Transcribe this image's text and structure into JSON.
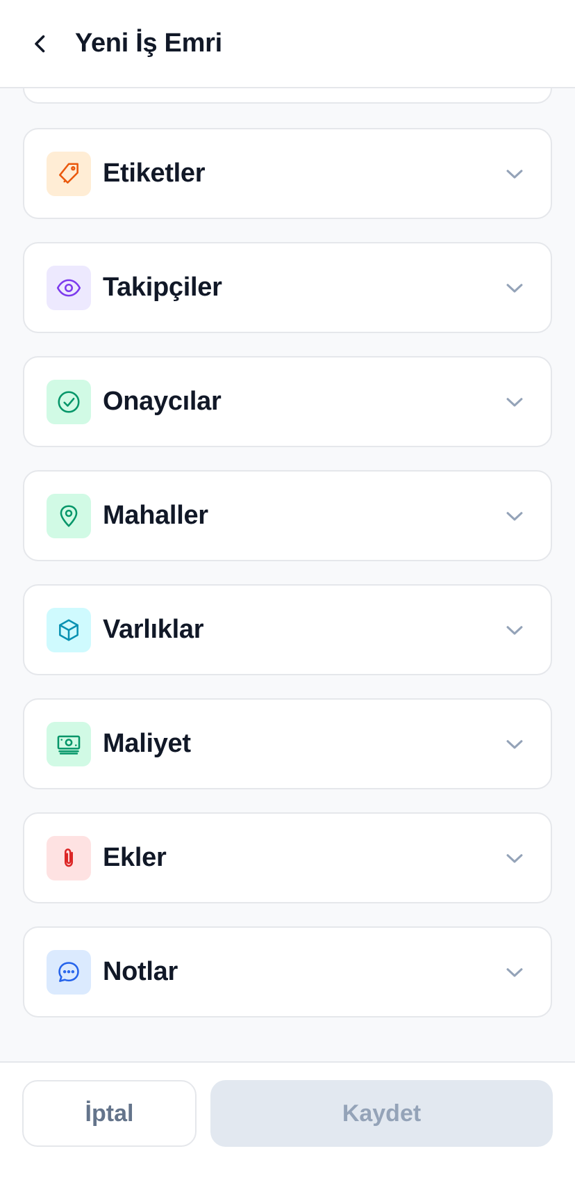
{
  "header": {
    "title": "Yeni İş Emri",
    "back_icon": "chevron-left-icon"
  },
  "sections": [
    {
      "key": "tags",
      "label": "Etiketler",
      "icon": "tag-icon",
      "icon_bg": "#ffedd5",
      "icon_color": "#ea580c"
    },
    {
      "key": "followers",
      "label": "Takipçiler",
      "icon": "eye-icon",
      "icon_bg": "#ede9fe",
      "icon_color": "#7c3aed"
    },
    {
      "key": "approvers",
      "label": "Onaycılar",
      "icon": "check-circle-icon",
      "icon_bg": "#d1fae5",
      "icon_color": "#059669"
    },
    {
      "key": "locations",
      "label": "Mahaller",
      "icon": "map-pin-icon",
      "icon_bg": "#d1fae5",
      "icon_color": "#059669"
    },
    {
      "key": "assets",
      "label": "Varlıklar",
      "icon": "cube-icon",
      "icon_bg": "#cffafe",
      "icon_color": "#0891b2"
    },
    {
      "key": "cost",
      "label": "Maliyet",
      "icon": "banknotes-icon",
      "icon_bg": "#d1fae5",
      "icon_color": "#059669"
    },
    {
      "key": "attachments",
      "label": "Ekler",
      "icon": "paperclip-icon",
      "icon_bg": "#fee2e2",
      "icon_color": "#dc2626"
    },
    {
      "key": "notes",
      "label": "Notlar",
      "icon": "chat-bubble-icon",
      "icon_bg": "#dbeafe",
      "icon_color": "#2563eb"
    }
  ],
  "footer": {
    "cancel_label": "İptal",
    "save_label": "Kaydet"
  },
  "colors": {
    "chevron": "#94a3b8",
    "title": "#111827",
    "border": "#e5e7eb",
    "background": "#f8f9fb"
  }
}
